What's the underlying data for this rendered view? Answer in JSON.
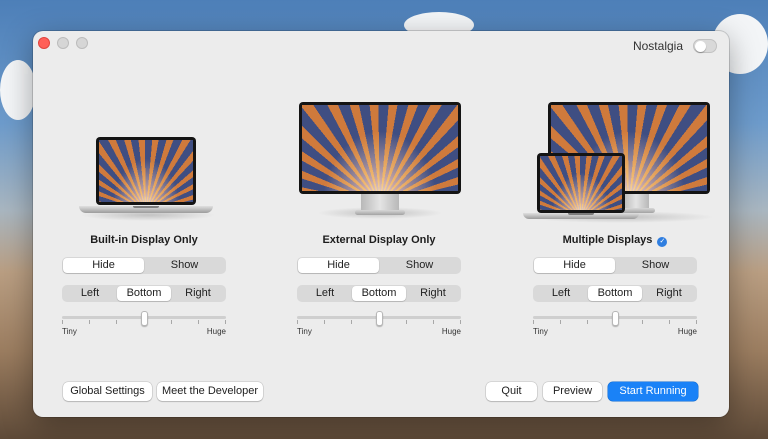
{
  "window": {
    "nostalgia_label": "Nostalgia",
    "nostalgia_on": false
  },
  "columns": [
    {
      "title": "Built-in Display Only",
      "selected": false,
      "visibility": {
        "options": [
          "Hide",
          "Show"
        ],
        "selected": "Hide"
      },
      "position": {
        "options": [
          "Left",
          "Bottom",
          "Right"
        ],
        "selected": "Bottom"
      },
      "size": {
        "min_label": "Tiny",
        "max_label": "Huge",
        "value": 0.5
      }
    },
    {
      "title": "External Display Only",
      "selected": false,
      "visibility": {
        "options": [
          "Hide",
          "Show"
        ],
        "selected": "Hide"
      },
      "position": {
        "options": [
          "Left",
          "Bottom",
          "Right"
        ],
        "selected": "Bottom"
      },
      "size": {
        "min_label": "Tiny",
        "max_label": "Huge",
        "value": 0.5
      }
    },
    {
      "title": "Multiple Displays",
      "selected": true,
      "visibility": {
        "options": [
          "Hide",
          "Show"
        ],
        "selected": "Hide"
      },
      "position": {
        "options": [
          "Left",
          "Bottom",
          "Right"
        ],
        "selected": "Bottom"
      },
      "size": {
        "min_label": "Tiny",
        "max_label": "Huge",
        "value": 0.5
      }
    }
  ],
  "footer": {
    "global_settings": "Global Settings",
    "meet_developer": "Meet the Developer",
    "quit": "Quit",
    "preview": "Preview",
    "start_running": "Start Running"
  },
  "colors": {
    "accent": "#1a82f7",
    "close": "#ff5f57"
  }
}
